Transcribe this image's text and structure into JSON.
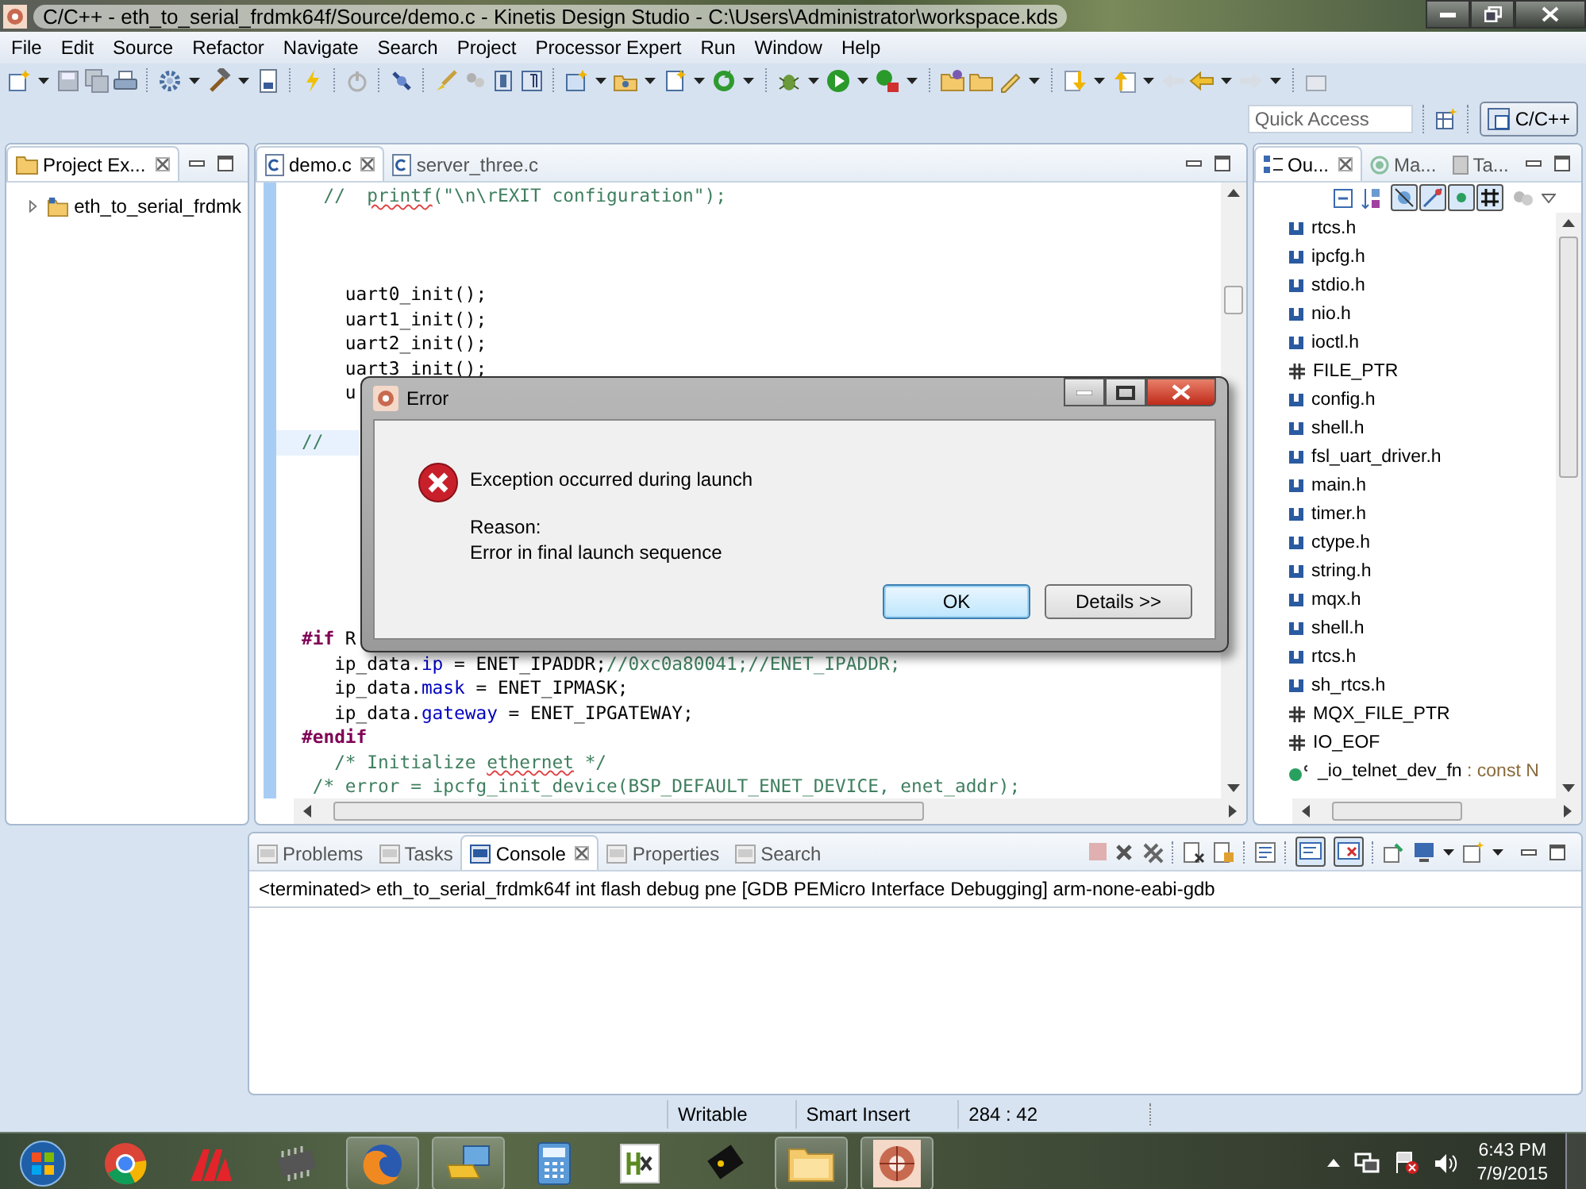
{
  "window": {
    "title": "C/C++ - eth_to_serial_frdmk64f/Source/demo.c - Kinetis Design Studio - C:\\Users\\Administrator\\workspace.kds"
  },
  "menu": [
    "File",
    "Edit",
    "Source",
    "Refactor",
    "Navigate",
    "Search",
    "Project",
    "Processor Expert",
    "Run",
    "Window",
    "Help"
  ],
  "quick_access": {
    "placeholder": "Quick Access"
  },
  "perspectives": [
    {
      "label": "C/C++",
      "selected": true
    }
  ],
  "project_explorer": {
    "tab": "Project Ex...",
    "items": [
      {
        "label": "eth_to_serial_frdmk",
        "expanded": false
      }
    ]
  },
  "editor": {
    "tabs": [
      {
        "label": "demo.c",
        "selected": true
      },
      {
        "label": "server_three.c",
        "selected": false
      }
    ],
    "lines": [
      {
        "kind": "code",
        "current": false,
        "tokens": [
          {
            "kind": "comment",
            "t": "  //  "
          },
          {
            "kind": "typo",
            "t": "printf"
          },
          {
            "kind": "comment",
            "t": "(\"\\n\\rEXIT configuration\");"
          }
        ]
      },
      {
        "kind": "blank"
      },
      {
        "kind": "blank"
      },
      {
        "kind": "blank"
      },
      {
        "kind": "code",
        "current": false,
        "tokens": [
          {
            "kind": "plain",
            "t": "    uart0_init();"
          }
        ]
      },
      {
        "kind": "code",
        "current": false,
        "tokens": [
          {
            "kind": "plain",
            "t": "    uart1_init();"
          }
        ]
      },
      {
        "kind": "code",
        "current": false,
        "tokens": [
          {
            "kind": "plain",
            "t": "    uart2_init();"
          }
        ]
      },
      {
        "kind": "code",
        "current": false,
        "tokens": [
          {
            "kind": "plain",
            "t": "    uart3_init();"
          }
        ]
      },
      {
        "kind": "code",
        "current": false,
        "tokens": [
          {
            "kind": "plain",
            "t": "    u"
          }
        ]
      },
      {
        "kind": "blank"
      },
      {
        "kind": "code",
        "current": true,
        "tokens": [
          {
            "kind": "comment",
            "t": "//"
          }
        ]
      },
      {
        "kind": "blank"
      },
      {
        "kind": "blank"
      },
      {
        "kind": "blank"
      },
      {
        "kind": "blank"
      },
      {
        "kind": "blank"
      },
      {
        "kind": "blank"
      },
      {
        "kind": "blank"
      },
      {
        "kind": "code",
        "current": false,
        "tokens": [
          {
            "kind": "directive",
            "t": "#if"
          },
          {
            "kind": "plain",
            "t": " R"
          }
        ]
      },
      {
        "kind": "code",
        "current": false,
        "tokens": [
          {
            "kind": "plain",
            "t": "   ip_data."
          },
          {
            "kind": "field",
            "t": "ip"
          },
          {
            "kind": "plain",
            "t": " = ENET_IPADDR;"
          },
          {
            "kind": "comment",
            "t": "//0xc0a80041;//ENET_IPADDR;"
          }
        ]
      },
      {
        "kind": "code",
        "current": false,
        "tokens": [
          {
            "kind": "plain",
            "t": "   ip_data."
          },
          {
            "kind": "field",
            "t": "mask"
          },
          {
            "kind": "plain",
            "t": " = ENET_IPMASK;"
          }
        ]
      },
      {
        "kind": "code",
        "current": false,
        "tokens": [
          {
            "kind": "plain",
            "t": "   ip_data."
          },
          {
            "kind": "field",
            "t": "gateway"
          },
          {
            "kind": "plain",
            "t": " = ENET_IPGATEWAY;"
          }
        ]
      },
      {
        "kind": "code",
        "current": false,
        "tokens": [
          {
            "kind": "directive",
            "t": "#endif"
          }
        ]
      },
      {
        "kind": "code",
        "current": false,
        "tokens": [
          {
            "kind": "comment",
            "t": "   /* Initialize "
          },
          {
            "kind": "typo",
            "t": "ethernet"
          },
          {
            "kind": "comment",
            "t": " */"
          }
        ]
      },
      {
        "kind": "code",
        "current": false,
        "tokens": [
          {
            "kind": "comment",
            "t": " /* error = ipcfg_init_device(BSP_DEFAULT_ENET_DEVICE, enet_addr);"
          }
        ]
      }
    ]
  },
  "outline": {
    "tabs": [
      {
        "label": "Ou...",
        "selected": true
      },
      {
        "label": "Ma...",
        "selected": false
      },
      {
        "label": "Ta...",
        "selected": false
      }
    ],
    "items": [
      {
        "kind": "include",
        "label": "rtcs.h"
      },
      {
        "kind": "include",
        "label": "ipcfg.h"
      },
      {
        "kind": "include",
        "label": "stdio.h"
      },
      {
        "kind": "include",
        "label": "nio.h"
      },
      {
        "kind": "include",
        "label": "ioctl.h"
      },
      {
        "kind": "macro",
        "label": "FILE_PTR"
      },
      {
        "kind": "include",
        "label": "config.h"
      },
      {
        "kind": "include",
        "label": "shell.h"
      },
      {
        "kind": "include",
        "label": "fsl_uart_driver.h"
      },
      {
        "kind": "include",
        "label": "main.h"
      },
      {
        "kind": "include",
        "label": "timer.h"
      },
      {
        "kind": "include",
        "label": "ctype.h"
      },
      {
        "kind": "include",
        "label": "string.h"
      },
      {
        "kind": "include",
        "label": "mqx.h"
      },
      {
        "kind": "include",
        "label": "shell.h"
      },
      {
        "kind": "include",
        "label": "rtcs.h"
      },
      {
        "kind": "include",
        "label": "sh_rtcs.h"
      },
      {
        "kind": "macro",
        "label": "MQX_FILE_PTR"
      },
      {
        "kind": "macro",
        "label": "IO_EOF"
      },
      {
        "kind": "variable",
        "label": "_io_telnet_dev_fn",
        "type": " : const N"
      }
    ]
  },
  "console": {
    "tabs": [
      {
        "label": "Problems",
        "selected": false
      },
      {
        "label": "Tasks",
        "selected": false
      },
      {
        "label": "Console",
        "selected": true
      },
      {
        "label": "Properties",
        "selected": false
      },
      {
        "label": "Search",
        "selected": false
      }
    ],
    "text": "<terminated> eth_to_serial_frdmk64f int flash debug pne [GDB PEMicro Interface Debugging] arm-none-eabi-gdb"
  },
  "status_bar": [
    "Writable",
    "Smart Insert",
    "284 : 42"
  ],
  "dialog": {
    "title": "Error",
    "message": "Exception occurred during launch",
    "reason_label": "Reason:",
    "reason": "Error in final launch sequence",
    "buttons": [
      {
        "label": "OK",
        "default": true
      },
      {
        "label": "Details >>",
        "default": false
      }
    ]
  },
  "taskbar": {
    "apps": [
      {
        "kind": "ring",
        "running": false
      },
      {
        "kind": "chevron",
        "running": false
      },
      {
        "kind": "chip",
        "running": false
      },
      {
        "kind": "orb",
        "running": true
      },
      {
        "kind": "computer",
        "running": true
      },
      {
        "kind": "calculator",
        "running": false
      },
      {
        "kind": "square",
        "running": false
      },
      {
        "kind": "board",
        "running": false
      },
      {
        "kind": "folder",
        "running": true
      },
      {
        "kind": "sphere",
        "running": true
      }
    ],
    "time": "6:43 PM",
    "date": "7/9/2015"
  }
}
